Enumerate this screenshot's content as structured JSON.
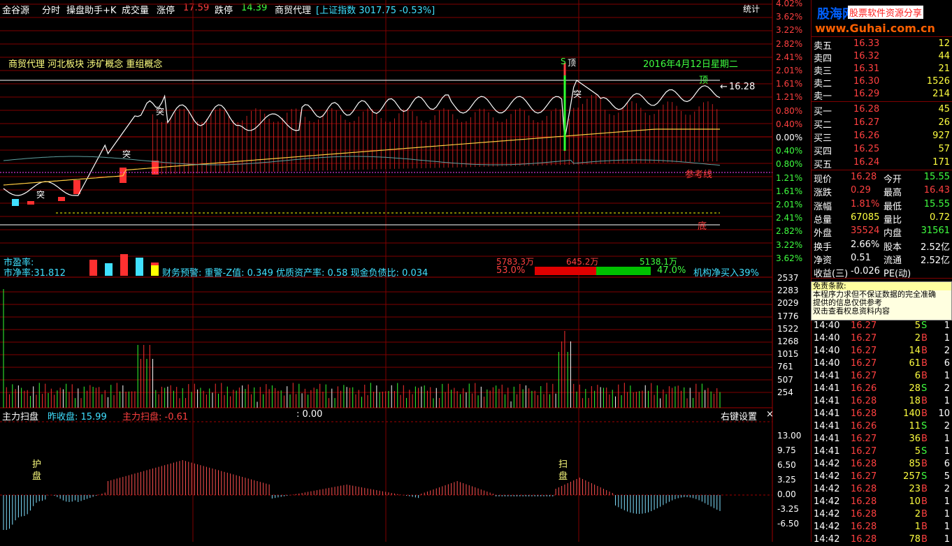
{
  "header": {
    "app": "金谷源",
    "view": "分时",
    "assistant": "操盘助手+K",
    "volume_label": "成交量",
    "limit_up_label": "涨停",
    "limit_up": "17.59",
    "limit_down_label": "跌停",
    "limit_down": "14.39",
    "stock_name": "商贸代理",
    "index_text": "[上证指数 3017.75 -0.53%]",
    "stats_button": "统计"
  },
  "logo": {
    "brand": "股海网",
    "slogan": "股票软件资源分享",
    "url": "www.Guhai.com.cn"
  },
  "concepts": "商贸代理 河北板块 涉矿概念 重组概念",
  "chart": {
    "date_label": "2016年4月12日星期二",
    "top_label": "顶",
    "bottom_label": "底",
    "ref_label": "参考线",
    "price_callout": "16.28",
    "break_label": "突",
    "sell_label": "S",
    "price_label": "顶"
  },
  "price_axis_right": [
    "4.02%",
    "3.62%",
    "3.22%",
    "2.82%",
    "2.41%",
    "2.01%",
    "1.61%",
    "1.21%",
    "0.80%",
    "0.40%",
    "0.00%",
    "0.40%",
    "0.80%",
    "1.21%",
    "1.61%",
    "2.01%",
    "2.41%",
    "2.82%",
    "3.22%",
    "3.62%"
  ],
  "fund_bar": {
    "pe_label": "市盈率:",
    "pb_label": "市净率:31.812",
    "warning": "财务预警: 重警-Z值: 0.349 优质资产率: 0.58 现金负债比: 0.034",
    "val1": "5783.3万",
    "val2": "645.2万",
    "val3": "5138.1万",
    "pct1": "53.0%",
    "pct2": "47.0%",
    "inst": "机构净买入39%"
  },
  "volume_axis": [
    "2537",
    "2283",
    "2029",
    "1776",
    "1522",
    "1268",
    "1015",
    "761",
    "507",
    "254"
  ],
  "scan": {
    "title": "主力扫盘",
    "prev_close_label": "昨收盘: 15.99",
    "scan_label": "主力扫盘: -0.61",
    "extra": ": 0.00",
    "settings": "右键设置",
    "close": "×",
    "guard_label": "护盘",
    "scan_mark": "扫盘",
    "axis": [
      "13.00",
      "9.75",
      "6.50",
      "3.25",
      "0.00",
      "-3.25",
      "-6.50"
    ]
  },
  "orderbook": {
    "asks": [
      {
        "label": "卖五",
        "price": "16.33",
        "vol": "12"
      },
      {
        "label": "卖四",
        "price": "16.32",
        "vol": "44"
      },
      {
        "label": "卖三",
        "price": "16.31",
        "vol": "21"
      },
      {
        "label": "卖二",
        "price": "16.30",
        "vol": "1526"
      },
      {
        "label": "卖一",
        "price": "16.29",
        "vol": "214"
      }
    ],
    "bids": [
      {
        "label": "买一",
        "price": "16.28",
        "vol": "45"
      },
      {
        "label": "买二",
        "price": "16.27",
        "vol": "26"
      },
      {
        "label": "买三",
        "price": "16.26",
        "vol": "927"
      },
      {
        "label": "买四",
        "price": "16.25",
        "vol": "57"
      },
      {
        "label": "买五",
        "price": "16.24",
        "vol": "171"
      }
    ],
    "stats": [
      {
        "l1": "现价",
        "v1": "16.28",
        "l2": "今开",
        "v2": "15.55",
        "c1": "#ff4040",
        "c2": "#40ff40"
      },
      {
        "l1": "涨跌",
        "v1": "0.29",
        "l2": "最高",
        "v2": "16.43",
        "c1": "#ff4040",
        "c2": "#ff4040"
      },
      {
        "l1": "涨幅",
        "v1": "1.81%",
        "l2": "最低",
        "v2": "15.55",
        "c1": "#ff4040",
        "c2": "#40ff40"
      },
      {
        "l1": "总量",
        "v1": "67085",
        "l2": "量比",
        "v2": "0.72",
        "c1": "#ffff40",
        "c2": "#ffff40"
      },
      {
        "l1": "外盘",
        "v1": "35524",
        "l2": "内盘",
        "v2": "31561",
        "c1": "#ff4040",
        "c2": "#40ff40"
      },
      {
        "l1": "换手",
        "v1": "2.66%",
        "l2": "股本",
        "v2": "2.52亿",
        "c1": "#ffffff",
        "c2": "#ffffff"
      },
      {
        "l1": "净资",
        "v1": "0.51",
        "l2": "流通",
        "v2": "2.52亿",
        "c1": "#ffffff",
        "c2": "#ffffff"
      },
      {
        "l1": "收益(三)",
        "v1": "-0.026",
        "l2": "PE(动)",
        "v2": "",
        "c1": "#ffffff",
        "c2": "#ffffff"
      }
    ],
    "disclaimer_title": "免责条款:",
    "disclaimer": [
      "本程序力求但不保证数据的完全准确",
      "提供的信息仅供参考",
      "双击查看权息资料内容"
    ],
    "trades": [
      {
        "t": "14:40",
        "p": "16.27",
        "v": "5",
        "s": "S",
        "n": "1"
      },
      {
        "t": "14:40",
        "p": "16.27",
        "v": "2",
        "s": "B",
        "n": "1"
      },
      {
        "t": "14:40",
        "p": "16.27",
        "v": "14",
        "s": "B",
        "n": "2"
      },
      {
        "t": "14:40",
        "p": "16.27",
        "v": "61",
        "s": "B",
        "n": "6"
      },
      {
        "t": "14:41",
        "p": "16.27",
        "v": "6",
        "s": "B",
        "n": "1"
      },
      {
        "t": "14:41",
        "p": "16.26",
        "v": "28",
        "s": "S",
        "n": "2"
      },
      {
        "t": "14:41",
        "p": "16.28",
        "v": "18",
        "s": "B",
        "n": "1"
      },
      {
        "t": "14:41",
        "p": "16.28",
        "v": "140",
        "s": "B",
        "n": "10"
      },
      {
        "t": "14:41",
        "p": "16.26",
        "v": "11",
        "s": "S",
        "n": "2"
      },
      {
        "t": "14:41",
        "p": "16.27",
        "v": "36",
        "s": "B",
        "n": "1"
      },
      {
        "t": "14:41",
        "p": "16.27",
        "v": "5",
        "s": "S",
        "n": "1"
      },
      {
        "t": "14:42",
        "p": "16.28",
        "v": "85",
        "s": "B",
        "n": "6"
      },
      {
        "t": "14:42",
        "p": "16.27",
        "v": "257",
        "s": "S",
        "n": "5"
      },
      {
        "t": "14:42",
        "p": "16.28",
        "v": "23",
        "s": "B",
        "n": "2"
      },
      {
        "t": "14:42",
        "p": "16.28",
        "v": "10",
        "s": "B",
        "n": "1"
      },
      {
        "t": "14:42",
        "p": "16.28",
        "v": "2",
        "s": "B",
        "n": "1"
      },
      {
        "t": "14:42",
        "p": "16.28",
        "v": "1",
        "s": "B",
        "n": "1"
      },
      {
        "t": "14:42",
        "p": "16.28",
        "v": "78",
        "s": "B",
        "n": "1"
      }
    ]
  },
  "colors": {
    "red": "#ff3030",
    "green": "#30ff30",
    "grid": "#800000",
    "white": "#ffffff"
  }
}
